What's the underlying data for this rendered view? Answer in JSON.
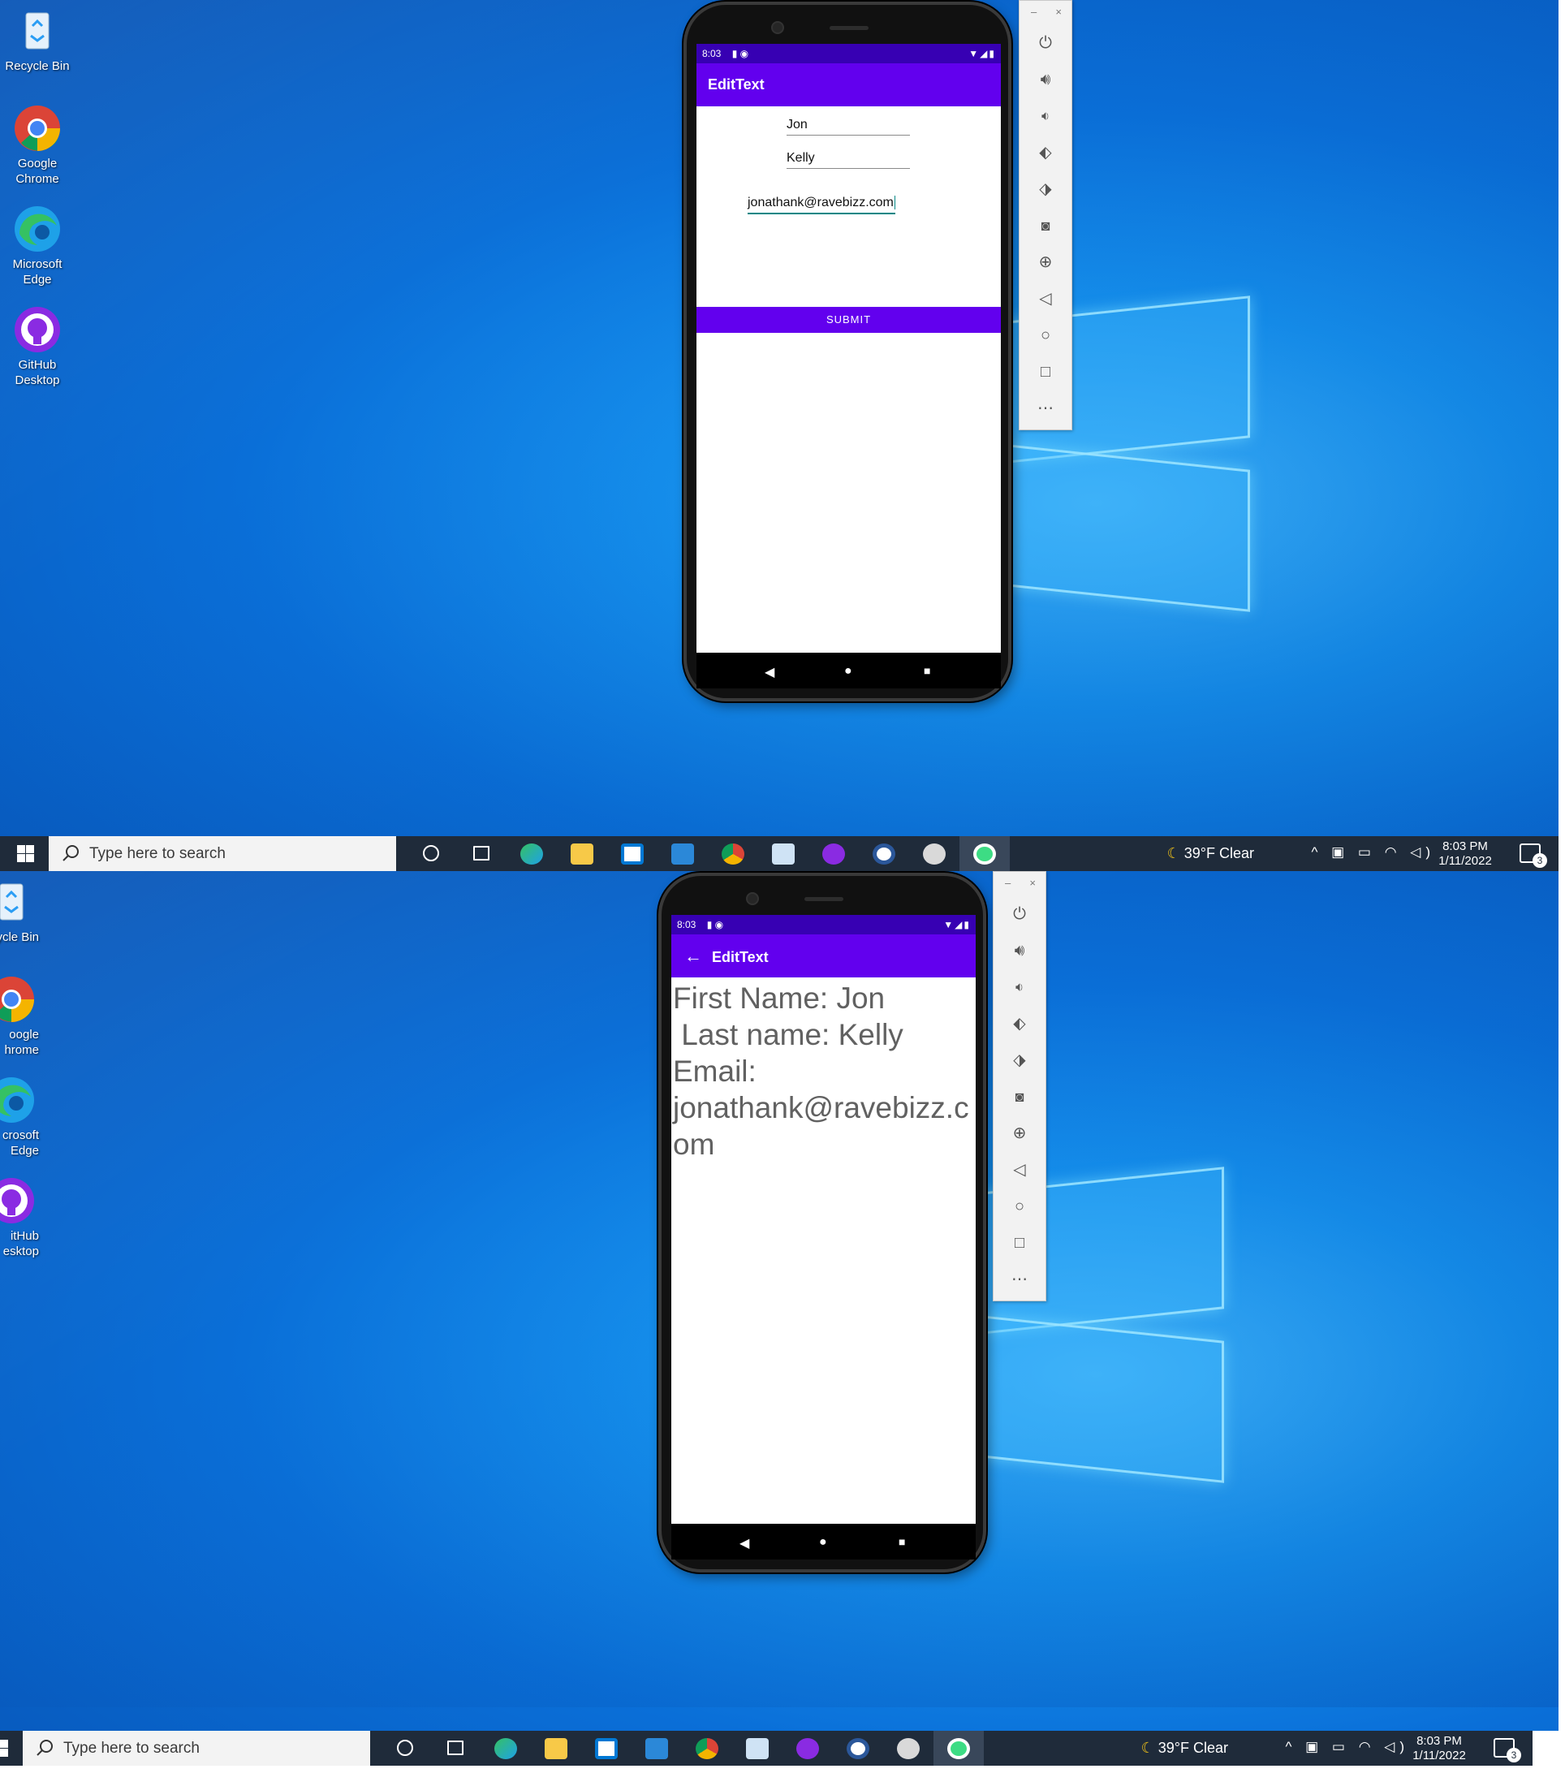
{
  "desktop_icons": [
    {
      "label": "Recycle Bin",
      "icon": "recycle-bin-icon"
    },
    {
      "label": "Google Chrome",
      "icon": "chrome-icon"
    },
    {
      "label": "Microsoft Edge",
      "icon": "edge-icon"
    },
    {
      "label": "GitHub Desktop",
      "icon": "github-desktop-icon"
    }
  ],
  "desktop_icons_cropped": [
    {
      "label": "ycle Bin"
    },
    {
      "label": "oogle hrome"
    },
    {
      "label": "crosoft Edge"
    },
    {
      "label": "itHub esktop"
    }
  ],
  "taskbar": {
    "search_placeholder": "Type here to search",
    "apps": [
      "cortana-icon",
      "task-view-icon",
      "edge-icon",
      "file-explorer-icon",
      "store-icon",
      "mail-icon",
      "chrome-icon",
      "photos-icon",
      "github-desktop-icon",
      "word-icon",
      "paint-icon",
      "android-studio-icon"
    ],
    "weather": "39°F  Clear",
    "time": "8:03 PM",
    "date": "1/11/2022",
    "notifications": "3"
  },
  "phone": {
    "status_time": "8:03",
    "app_title": "EditText",
    "first_name": "Jon",
    "last_name": "Kelly",
    "email": "jonathank@ravebizz.com",
    "submit_label": "SUBMIT",
    "result_text": "First Name: Jon\n Last name: Kelly\nEmail:\njonathank@ravebizz.com"
  },
  "emulator_controls": [
    "power-icon",
    "volume-up-icon",
    "volume-down-icon",
    "rotate-left-icon",
    "rotate-right-icon",
    "camera-icon",
    "zoom-icon",
    "back-icon",
    "home-icon",
    "overview-icon",
    "more-icon"
  ],
  "colors": {
    "primary": "#6200ee",
    "primary_dark": "#3700b3",
    "desktop_blue": "#0a6fd8"
  }
}
